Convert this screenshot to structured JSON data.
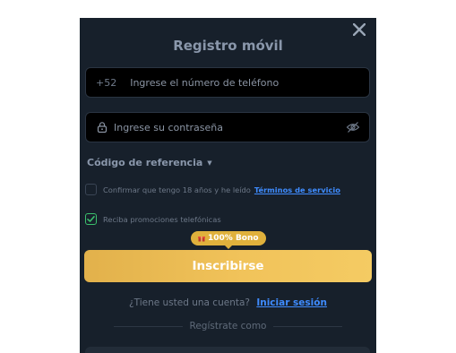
{
  "modal": {
    "title": "Registro móvil",
    "close_icon": "close-icon"
  },
  "phone": {
    "prefix": "+52",
    "placeholder": "Ingrese el número de teléfono",
    "value": ""
  },
  "password": {
    "placeholder": "Ingrese su contraseña",
    "value": "",
    "lock_icon": "lock-icon",
    "eye_icon": "eye-off-icon"
  },
  "referral": {
    "label": "Código de referencia",
    "caret_icon": "caret-down-icon"
  },
  "age_check": {
    "label": "Confirmar que tengo 18 años y he leído",
    "link": "Términos de servicio",
    "checked": false
  },
  "promo_check": {
    "label": "Reciba promociones telefónicas",
    "checked": true
  },
  "bonus": {
    "label": "100% Bono",
    "icon": "gift-icon"
  },
  "submit": {
    "label": "Inscribirse"
  },
  "account": {
    "question": "¿Tiene usted una cuenta?",
    "login": "Iniciar sesión"
  },
  "register_as": {
    "label": "Regístrate como"
  },
  "colors": {
    "modal_bg": "#17202b",
    "accent_gold": "#f1c35a",
    "link_blue": "#3f8cff",
    "check_green": "#3bbf6c"
  }
}
